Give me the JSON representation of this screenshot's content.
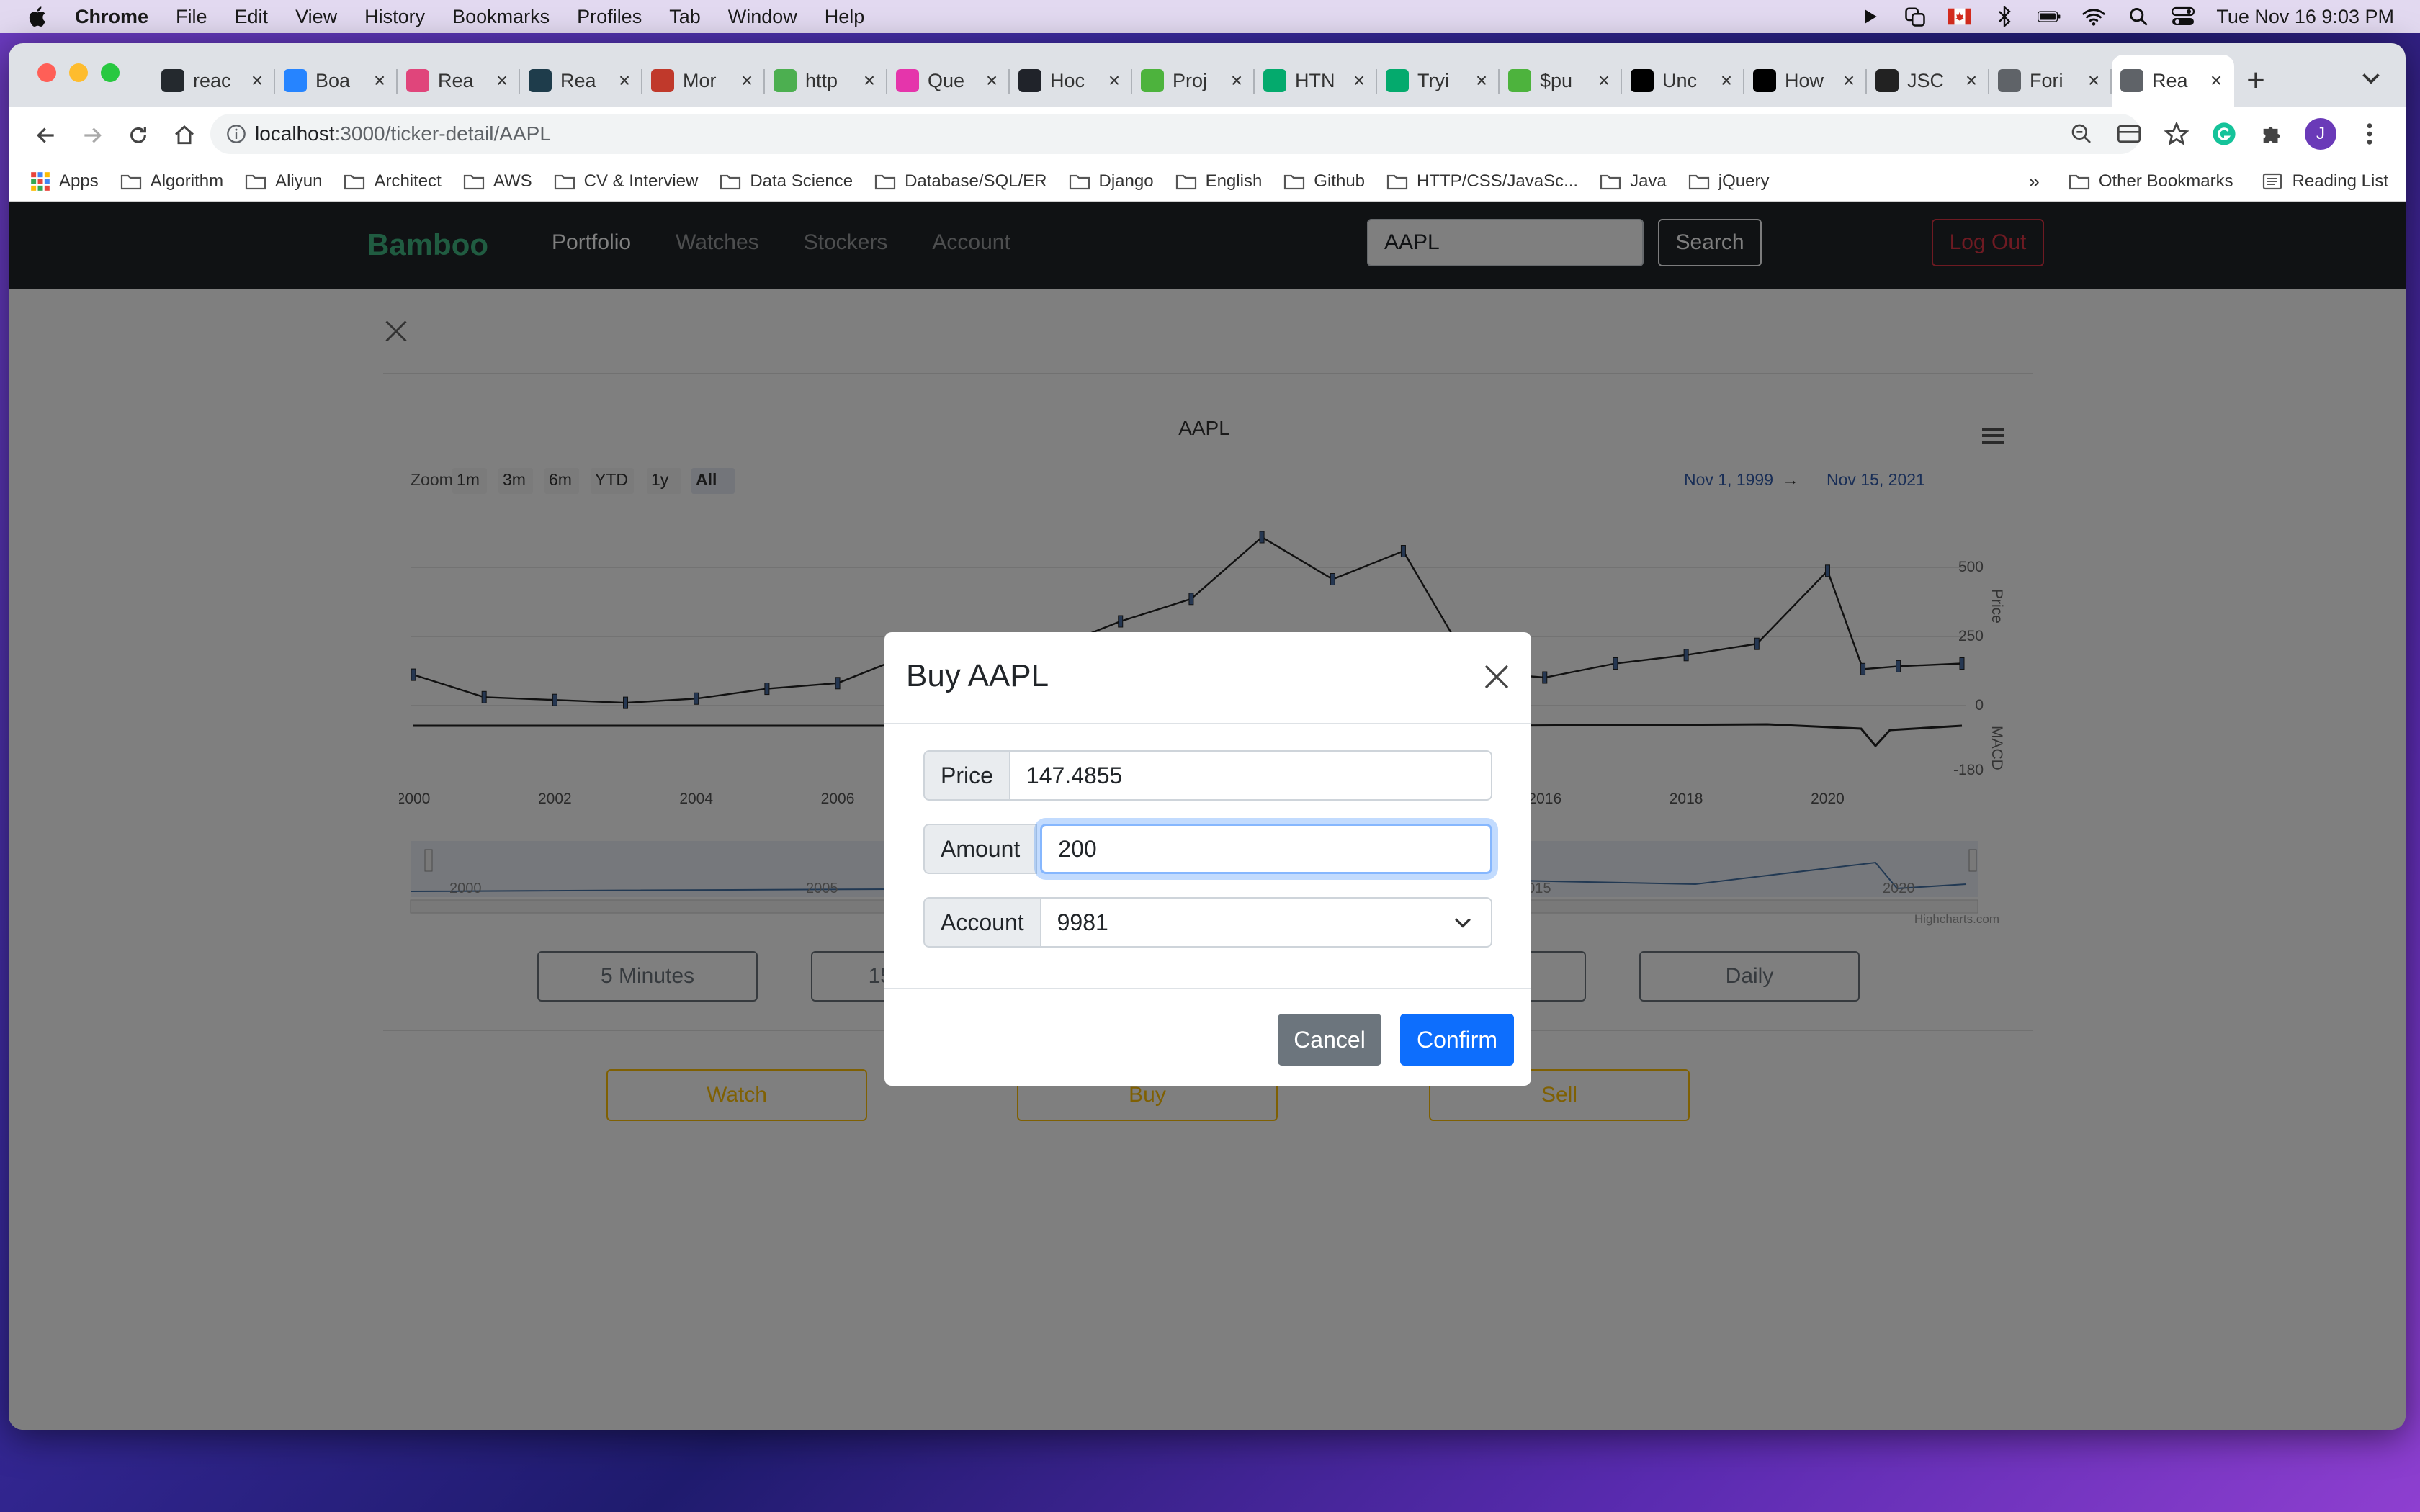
{
  "menubar": {
    "items": [
      "Chrome",
      "File",
      "Edit",
      "View",
      "History",
      "Bookmarks",
      "Profiles",
      "Tab",
      "Window",
      "Help"
    ],
    "clock": "Tue Nov 16  9:03 PM"
  },
  "tabs": [
    {
      "title": "reac",
      "icon": "github-icon",
      "color": "#24292e"
    },
    {
      "title": "Boa",
      "icon": "jira-icon",
      "color": "#2684ff"
    },
    {
      "title": "Rea",
      "icon": "graph-icon",
      "color": "#e0457b"
    },
    {
      "title": "Rea",
      "icon": "react-icon",
      "color": "#1e3c4b"
    },
    {
      "title": "Mor",
      "icon": "m-icon",
      "color": "#c0392b"
    },
    {
      "title": "http",
      "icon": "heart-icon",
      "color": "#4caf50"
    },
    {
      "title": "Que",
      "icon": "graphql-icon",
      "color": "#e535ab"
    },
    {
      "title": "Hoc",
      "icon": "react-icon",
      "color": "#20232a"
    },
    {
      "title": "Proj",
      "icon": "mongo-icon",
      "color": "#4db33d"
    },
    {
      "title": "HTN",
      "icon": "w3-icon",
      "color": "#04aa6d"
    },
    {
      "title": "Tryi",
      "icon": "w3-icon",
      "color": "#04aa6d"
    },
    {
      "title": "$pu",
      "icon": "mongo-icon",
      "color": "#4db33d"
    },
    {
      "title": "Unc",
      "icon": "medium-icon",
      "color": "#000000"
    },
    {
      "title": "How",
      "icon": "medium-icon",
      "color": "#000000"
    },
    {
      "title": "JSC",
      "icon": "json-icon",
      "color": "#222222"
    },
    {
      "title": "Fori",
      "icon": "globe-icon",
      "color": "#5f6368"
    },
    {
      "title": "Rea",
      "icon": "globe-icon",
      "color": "#5f6368",
      "active": true
    }
  ],
  "address": {
    "host": "localhost",
    "path": ":3000/ticker-detail/AAPL"
  },
  "bookmarks": [
    "Apps",
    "Algorithm",
    "Aliyun",
    "Architect",
    "AWS",
    "CV & Interview",
    "Data Science",
    "Database/SQL/ER",
    "Django",
    "English",
    "Github",
    "HTTP/CSS/JavaSc...",
    "Java",
    "jQuery"
  ],
  "bookmarks_right": {
    "more": "»",
    "other": "Other Bookmarks",
    "reading": "Reading List"
  },
  "app": {
    "brand": "Bamboo",
    "nav": [
      "Portfolio",
      "Watches",
      "Stockers",
      "Account"
    ],
    "search_value": "AAPL",
    "search_label": "Search",
    "logout_label": "Log Out"
  },
  "periods": [
    "5 Minutes",
    "15 Minutes",
    "",
    "Daily"
  ],
  "actions": {
    "watch": "Watch",
    "buy": "Buy",
    "sell": "Sell"
  },
  "chart_data": {
    "type": "line",
    "title": "AAPL",
    "zoom_label": "Zoom",
    "zoom_buttons": [
      "1m",
      "3m",
      "6m",
      "YTD",
      "1y",
      "All"
    ],
    "selected_zoom": "All",
    "range_from": "Nov 1, 1999",
    "range_arrow": "→",
    "range_to": "Nov 15, 2021",
    "x_ticks": [
      "2000",
      "2002",
      "2004",
      "2006",
      "2008",
      "2010",
      "2012",
      "2014",
      "2016",
      "2018",
      "2020"
    ],
    "nav_ticks": [
      "2000",
      "2005",
      "2010",
      "2015",
      "2020"
    ],
    "price_ticks": [
      "500",
      "250",
      "0"
    ],
    "macd_ticks": [
      "-180"
    ],
    "price_label": "Price",
    "macd_label": "MACD",
    "credits": "Highcharts.com",
    "x": [
      2000,
      2001,
      2002,
      2003,
      2004,
      2005,
      2006,
      2007,
      2008,
      2009,
      2010,
      2011,
      2012,
      2013,
      2014,
      2015,
      2016,
      2017,
      2018,
      2019,
      2020,
      2020.5,
      2021,
      2021.9
    ],
    "series": [
      {
        "name": "Price",
        "values": [
          110,
          30,
          20,
          10,
          25,
          60,
          80,
          180,
          120,
          200,
          300,
          380,
          600,
          450,
          550,
          120,
          100,
          150,
          180,
          220,
          480,
          130,
          140,
          150
        ]
      }
    ]
  },
  "modal": {
    "title": "Buy AAPL",
    "price_label": "Price",
    "price_value": "147.4855",
    "amount_label": "Amount",
    "amount_value": "200",
    "account_label": "Account",
    "account_value": "9981",
    "cancel_label": "Cancel",
    "confirm_label": "Confirm"
  }
}
